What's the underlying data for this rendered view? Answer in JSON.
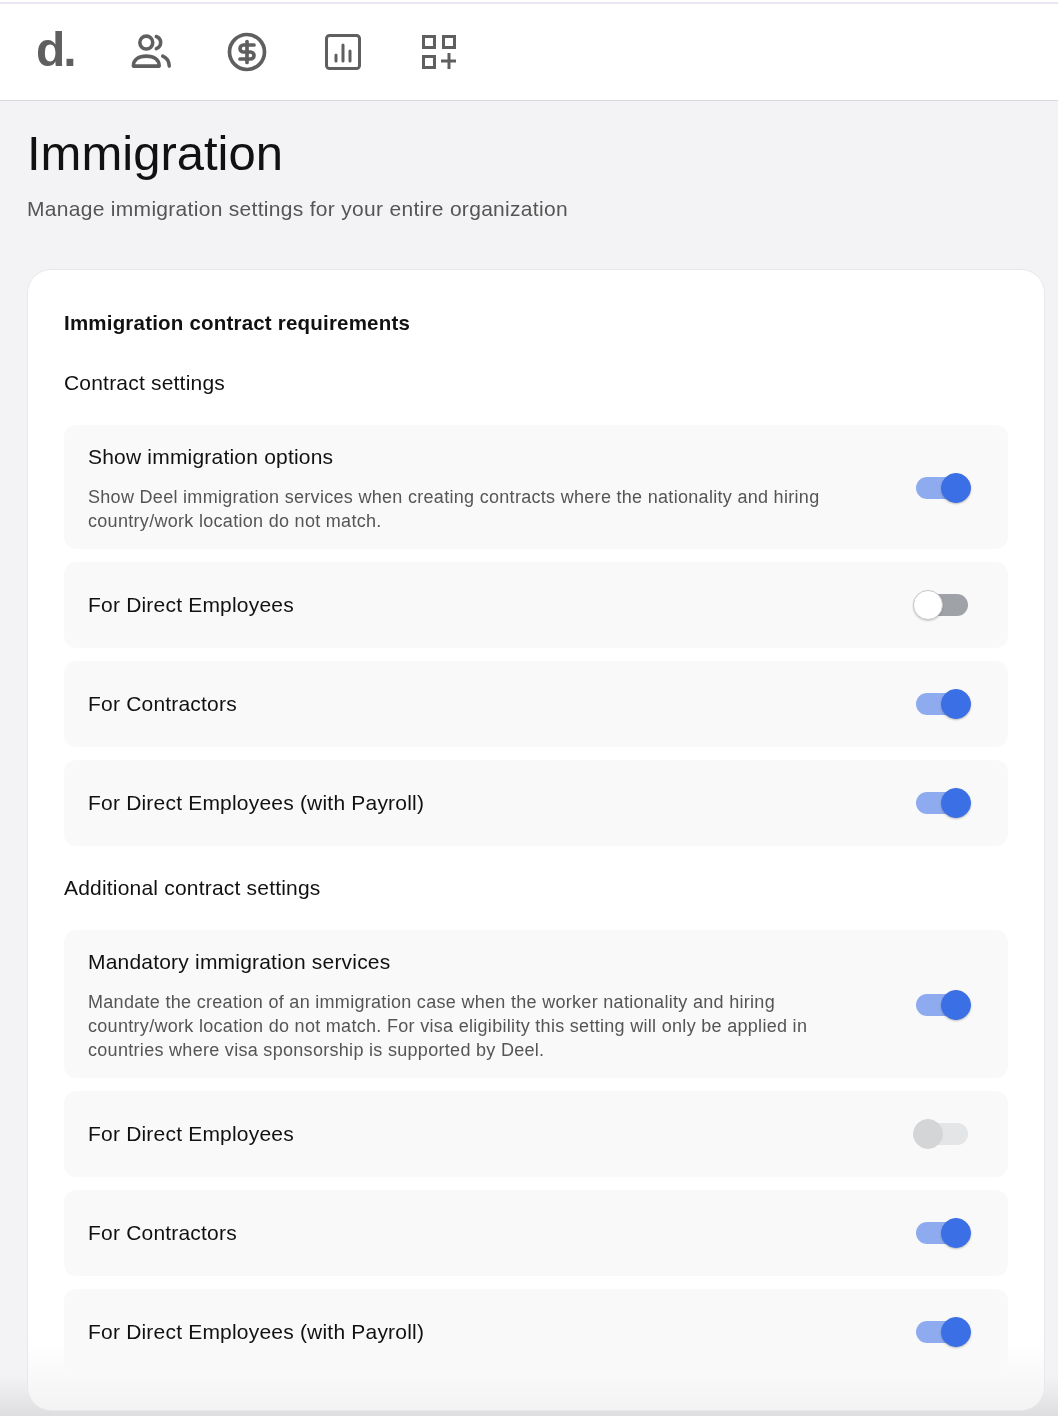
{
  "nav": {
    "logo": "d."
  },
  "header": {
    "title": "Immigration",
    "subtitle": "Manage immigration settings for your entire organization"
  },
  "card": {
    "heading": "Immigration contract requirements",
    "sections": [
      {
        "title": "Contract settings",
        "settings": [
          {
            "label": "Show immigration options",
            "description": "Show Deel immigration services when creating contracts where the nationality and hiring country/work location do not match.",
            "on": true,
            "disabled": false
          },
          {
            "label": "For Direct Employees",
            "on": false,
            "disabled": false
          },
          {
            "label": "For Contractors",
            "on": true,
            "disabled": false
          },
          {
            "label": "For Direct Employees (with Payroll)",
            "on": true,
            "disabled": false
          }
        ]
      },
      {
        "title": "Additional contract settings",
        "settings": [
          {
            "label": "Mandatory immigration services",
            "description": "Mandate the creation of an immigration case when the worker nationality and hiring country/work location do not match. For visa eligibility this setting will only be applied in countries where visa sponsorship is supported by Deel.",
            "on": true,
            "disabled": false
          },
          {
            "label": "For Direct Employees",
            "on": false,
            "disabled": true
          },
          {
            "label": "For Contractors",
            "on": true,
            "disabled": false
          },
          {
            "label": "For Direct Employees (with Payroll)",
            "on": true,
            "disabled": false
          }
        ]
      }
    ]
  }
}
